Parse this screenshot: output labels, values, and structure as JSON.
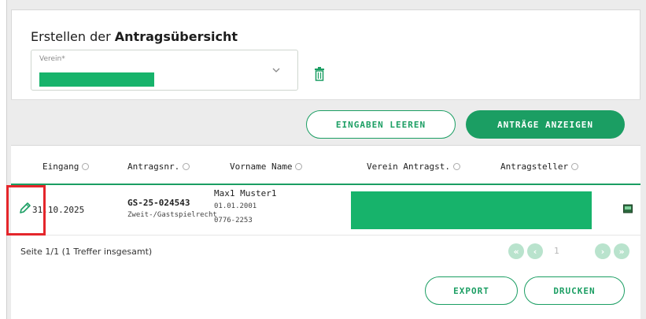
{
  "header": {
    "title_prefix": "Erstellen der",
    "title_bold": "Antragsübersicht"
  },
  "form": {
    "verein_label": "Verein*"
  },
  "actions": {
    "clear_label": "EINGABEN LEEREN",
    "show_label": "ANTRÄGE ANZEIGEN"
  },
  "table": {
    "columns": [
      "Eingang",
      "Antragsnr.",
      "Vorname Name",
      "Verein Antragst.",
      "Antragsteller"
    ],
    "rows": [
      {
        "eingang": "31.10.2025",
        "antragsnr": "GS-25-024543",
        "antragsnr_sub": "Zweit-/Gastspielrecht",
        "name": "Max1 Muster1",
        "dob": "01.01.2001",
        "id": "0776-2253"
      }
    ]
  },
  "pagination": {
    "summary": "Seite 1/1 (1 Treffer insgesamt)",
    "current_page": "1"
  },
  "footer": {
    "export_label": "EXPORT",
    "print_label": "DRUCKEN"
  },
  "colors": {
    "accent": "#1b9e63",
    "highlight": "#e4262b",
    "redaction": "#17b36b"
  }
}
